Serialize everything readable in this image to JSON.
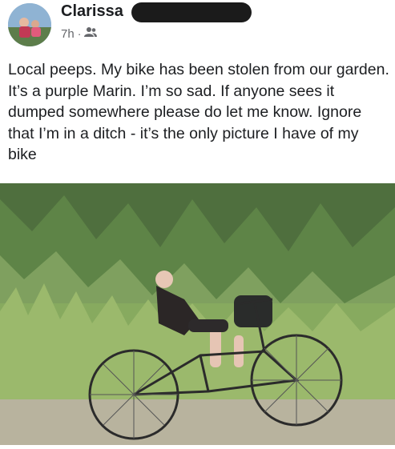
{
  "post": {
    "author": "Clarissa",
    "timestamp": "7h",
    "separator": "·",
    "audience_icon": "friends-icon",
    "text": "Local peeps. My bike has been stolen from our garden. It’s a purple Marin.  I’m so sad.  If anyone sees it dumped somewhere please do let me know. Ignore that I’m in a ditch - it’s the only picture I have of my bike"
  },
  "colors": {
    "text": "#1c1e21",
    "meta": "#65676b",
    "redaction": "#1b1b1b"
  }
}
